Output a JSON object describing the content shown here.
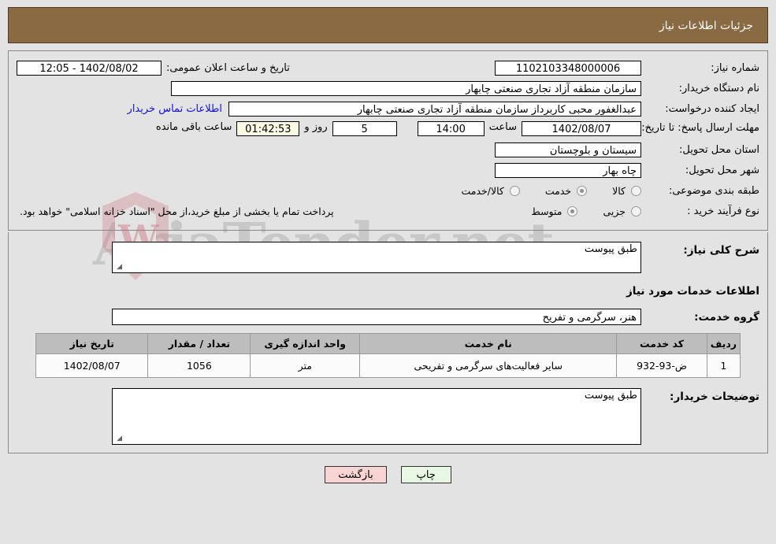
{
  "header": {
    "title": "جزئیات اطلاعات نیاز"
  },
  "watermark": {
    "text": "AriaTender.net",
    "mark": "W"
  },
  "form": {
    "need_number_label": "شماره نیاز:",
    "need_number_value": "1102103348000006",
    "announce_label": "تاریخ و ساعت اعلان عمومی:",
    "announce_value": "1402/08/02 - 12:05",
    "buyer_org_label": "نام دستگاه خریدار:",
    "buyer_org_value": "سازمان منطقه آزاد تجاری صنعتی چابهار",
    "creator_label": "ایجاد کننده درخواست:",
    "creator_value": "عبدالغفور محبی کاربرداز سازمان منطقه آزاد تجاری صنعتی چابهار",
    "contact_link": "اطلاعات تماس خریدار",
    "deadline_label": "مهلت ارسال پاسخ: تا تاریخ:",
    "deadline_date": "1402/08/07",
    "hour_label": "ساعت",
    "deadline_time": "14:00",
    "days_value": "5",
    "days_label": "روز و",
    "countdown_value": "01:42:53",
    "countdown_label": "ساعت باقی مانده",
    "province_label": "استان محل تحویل:",
    "province_value": "سیستان و بلوچستان",
    "city_label": "شهر محل تحویل:",
    "city_value": "چاه بهار",
    "category_label": "طبقه بندی موضوعی:",
    "category_options": [
      {
        "label": "کالا",
        "selected": false
      },
      {
        "label": "خدمت",
        "selected": true
      },
      {
        "label": "کالا/خدمت",
        "selected": false
      }
    ],
    "process_label": "نوع فرآیند خرید :",
    "process_options": [
      {
        "label": "جزیی",
        "selected": false
      },
      {
        "label": "متوسط",
        "selected": true
      }
    ],
    "payment_note": "پرداخت تمام یا بخشی از مبلغ خرید،از محل \"اسناد خزانه اسلامی\" خواهد بود."
  },
  "description": {
    "overall_label": "شرح کلی نیاز:",
    "overall_value": "طبق پیوست",
    "section_title": "اطلاعات خدمات مورد نیاز",
    "service_group_label": "گروه خدمت:",
    "service_group_value": "هنر، سرگرمی و تفریح"
  },
  "table": {
    "columns": [
      "ردیف",
      "کد خدمت",
      "نام خدمت",
      "واحد اندازه گیری",
      "تعداد / مقدار",
      "تاریخ نیاز"
    ],
    "rows": [
      {
        "index": "1",
        "code": "ض-93-932",
        "name": "سایر فعالیت‌های سرگرمی و تفریحی",
        "unit": "متر",
        "quantity": "1056",
        "date": "1402/08/07"
      }
    ]
  },
  "buyer_notes": {
    "label": "توضیحات خریدار:",
    "value": "طبق پیوست"
  },
  "buttons": {
    "print": "چاپ",
    "back": "بازگشت"
  }
}
